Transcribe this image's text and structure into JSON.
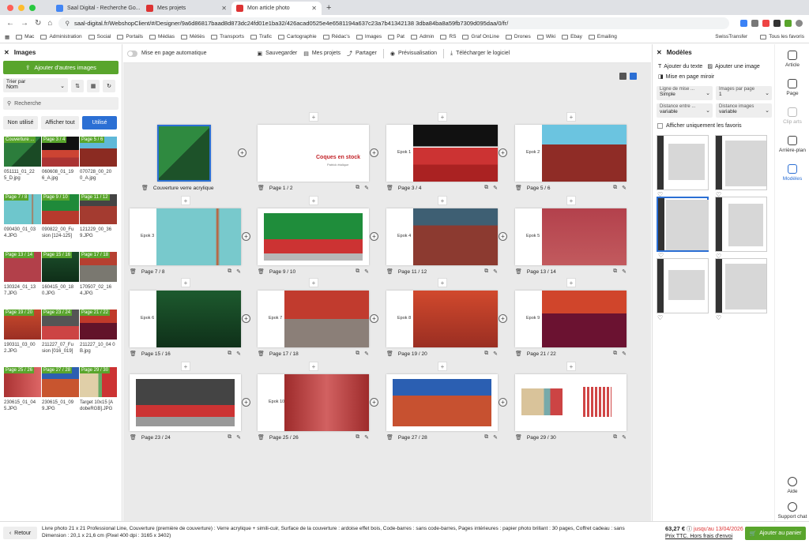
{
  "browser": {
    "tabs": [
      {
        "label": "Saal Digital - Recherche Go..."
      },
      {
        "label": "Mes projets"
      },
      {
        "label": "Mon article photo"
      }
    ],
    "url": "saal-digital.fr/WebshopClient/#/Designer/9a6d86817baad8d873dc24fd01e1ba32/426acad0525e4e6581194a637c23a7b41342138 3dba84ba8a59fb7309d095daa/0/fr/",
    "bookmarks": [
      "Mac",
      "Administration",
      "Social",
      "Portails",
      "Médias",
      "Métiès",
      "Transports",
      "Trafic",
      "Cartographie",
      "Rédac's",
      "Images",
      "Pat",
      "Admin",
      "RS",
      "Graf OnLine",
      "Drones",
      "Wiki",
      "Ebay",
      "Emailing"
    ],
    "bookmark_right": [
      "SwissTransfer",
      "Tous les favoris"
    ],
    "colors": {
      "green": "#59a52c",
      "blue": "#2b6fd4"
    }
  },
  "left_panel": {
    "title": "Images",
    "add_button": "Ajouter d'autres images",
    "sort_label": "Trier par",
    "sort_value": "Nom",
    "search_placeholder": "Recherche",
    "filters": [
      "Non utilisé",
      "Afficher tout",
      "Utilisé"
    ],
    "thumbnails": [
      {
        "badge": "Couverture ...",
        "caption": "051111_01_22 5_D.jpg"
      },
      {
        "badge": "Page 3 / 4",
        "caption": "060608_01_19 6_A.jpg"
      },
      {
        "badge": "Page 5 / 6",
        "caption": "070728_00_20 0_A.jpg"
      },
      {
        "badge": "Page 7 / 8",
        "caption": "090430_01_03 4.JPG"
      },
      {
        "badge": "Page 9 / 10",
        "caption": "090822_00_Fu sion [124-125] 120x50.JPG"
      },
      {
        "badge": "Page 11 / 12",
        "caption": "121229_00_36 9.JPG"
      },
      {
        "badge": "Page 13 / 14",
        "caption": "130324_01_13 7.JPG"
      },
      {
        "badge": "Page 15 / 16",
        "caption": "160415_00_18 0.JPG"
      },
      {
        "badge": "Page 17 / 18",
        "caption": "170507_02_16 4.JPG"
      },
      {
        "badge": "Page 19 / 20",
        "caption": "190311_03_00 2.JPG"
      },
      {
        "badge": "Page 23 / 24",
        "caption": "211227_07_Fu sion [016_019] 120x40.JPG"
      },
      {
        "badge": "Page 21 / 22",
        "caption": "211227_10_04 0 B.jpg"
      },
      {
        "badge": "Page 25 / 26",
        "caption": "230615_01_04 5.JPG"
      },
      {
        "badge": "Page 27 / 28",
        "caption": "230615_01_09 9.JPG"
      },
      {
        "badge": "Page 29 / 30",
        "caption": "Target 10x15 [A dobeRGB].JPG"
      }
    ]
  },
  "toolbar": {
    "auto_layout": "Mise en page automatique",
    "save": "Sauvegarder",
    "projects": "Mes projets",
    "share": "Partager",
    "preview": "Prévisualisation",
    "download": "Télécharger le logiciel"
  },
  "spreads": [
    {
      "label": "Couverture verre acrylique"
    },
    {
      "label": "Page 1 / 2",
      "title": "Coques en stock",
      "subtitle": "Patrick étalique"
    },
    {
      "label": "Page 3 / 4",
      "epok": "Epok 1"
    },
    {
      "label": "Page 5 / 6",
      "epok": "Epok 2"
    },
    {
      "label": "Page 7 / 8",
      "epok": "Epok 3"
    },
    {
      "label": "Page 9 / 10"
    },
    {
      "label": "Page 11 / 12",
      "epok": "Epok 4"
    },
    {
      "label": "Page 13 / 14",
      "epok": "Epok 5"
    },
    {
      "label": "Page 15 / 16",
      "epok": "Epok 6"
    },
    {
      "label": "Page 17 / 18",
      "epok": "Epok 7"
    },
    {
      "label": "Page 19 / 20",
      "epok": "Epok 8"
    },
    {
      "label": "Page 21 / 22",
      "epok": "Epok 9"
    },
    {
      "label": "Page 23 / 24"
    },
    {
      "label": "Page 25 / 26",
      "epok": "Epok 10"
    },
    {
      "label": "Page 27 / 28"
    },
    {
      "label": "Page 29 / 30"
    }
  ],
  "right_panel": {
    "title": "Modèles",
    "add_text": "Ajouter du texte",
    "add_image": "Ajouter une image",
    "mirror": "Mise en page miroir",
    "selects": [
      {
        "label": "Ligne de mise ...",
        "value": "Simple"
      },
      {
        "label": "Images par page",
        "value": "1"
      },
      {
        "label": "Distance entre ...",
        "value": "variable"
      },
      {
        "label": "Distance images",
        "value": "variable"
      }
    ],
    "favorites_only": "Afficher uniquement les favoris"
  },
  "rail": {
    "items": [
      "Article",
      "Page",
      "Clip arts",
      "Arrière-plan",
      "Modèles"
    ],
    "help": "Aide",
    "support": "Support chat"
  },
  "bottom": {
    "back": "Retour",
    "description": "Livre photo 21 x 21 Professional Line, Couverture (première de couverture) : Verre acrylique + simili-cuir, Surface de la couverture : ardoise effet bois, Code-barres : sans code-barres, Pages intérieures : papier photo brillant : 30 pages, Coffret cadeau : sans Dimension : 20,1 x 21,6 cm (Pixel 400 dpi : 3165 x 3402)",
    "price": "63,27 €",
    "until": "jusqu'au 13/04/2026",
    "ttc": "Prix TTC. Hors frais d'envoi",
    "cart": "Ajouter au panier"
  }
}
